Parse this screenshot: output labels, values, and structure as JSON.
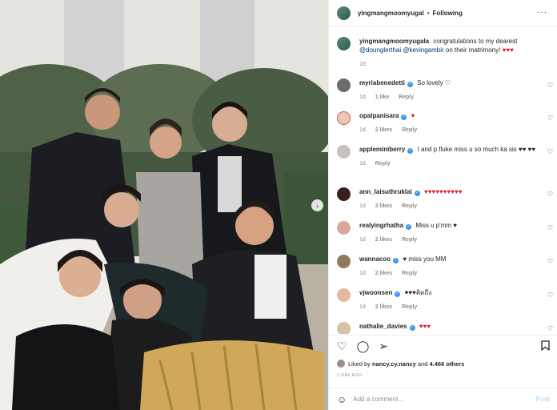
{
  "post": {
    "username": "yingmangmoomyugal",
    "separator": "•",
    "follow_label": "Following",
    "more_glyph": "···",
    "next_glyph": "›"
  },
  "caption": {
    "username": "yingmangmoomyugala",
    "text_before": "congratulations to my dearest",
    "mention1": "@dounglerthai",
    "mention2": "@kevingambir",
    "text_after": "on their matrimony!",
    "hearts": "♥♥♥",
    "time": "1d"
  },
  "comments": [
    {
      "username": "myriabenedetti",
      "verified": true,
      "text": "So lovely ♡",
      "time": "1d",
      "likes": "1 like",
      "reply": "Reply"
    },
    {
      "username": "opalpanisara",
      "verified": true,
      "text": "♥",
      "time": "1d",
      "likes": "2 likes",
      "reply": "Reply"
    },
    {
      "username": "appleminiberry",
      "verified": true,
      "text": "I and p fluke miss u so much ka sis ♥♥ ♥♥",
      "time": "1d",
      "likes": "",
      "reply": "Reply"
    },
    {
      "username": "ann_laisuthruklai",
      "verified": true,
      "text": "♥♥♥♥♥♥♥♥♥♥",
      "time": "1d",
      "likes": "3 likes",
      "reply": "Reply"
    },
    {
      "username": "realyingrhatha",
      "verified": true,
      "text": "Miss u p'mm ♥",
      "time": "1d",
      "likes": "2 likes",
      "reply": "Reply"
    },
    {
      "username": "wannacoo",
      "verified": true,
      "text": "♥ miss you MM",
      "time": "1d",
      "likes": "2 likes",
      "reply": "Reply"
    },
    {
      "username": "vjwoonsen",
      "verified": true,
      "text": "♥♥♥คิดถึง",
      "time": "1d",
      "likes": "2 likes",
      "reply": "Reply"
    },
    {
      "username": "nathalie_davies",
      "verified": true,
      "text": "♥♥♥",
      "time": "",
      "likes": "",
      "reply": ""
    }
  ],
  "actions": {
    "liked_by_prefix": "Liked by",
    "liked_by_user": "nancy.cy.nancy",
    "and_label": "and",
    "others_count": "4.466 others",
    "time_ago": "1 DAY AGO"
  },
  "add_comment": {
    "placeholder": "Add a comment…",
    "post_label": "Post"
  },
  "colors": {
    "heart_red": "#e0182d",
    "verified_blue": "#3897f0",
    "mention_blue": "#00376b",
    "post_disabled": "#b2dffc"
  },
  "icons": [
    "heart-icon",
    "comment-icon",
    "share-icon",
    "bookmark-icon",
    "emoji-icon",
    "more-icon",
    "chevron-right-icon",
    "verified-badge-icon"
  ]
}
